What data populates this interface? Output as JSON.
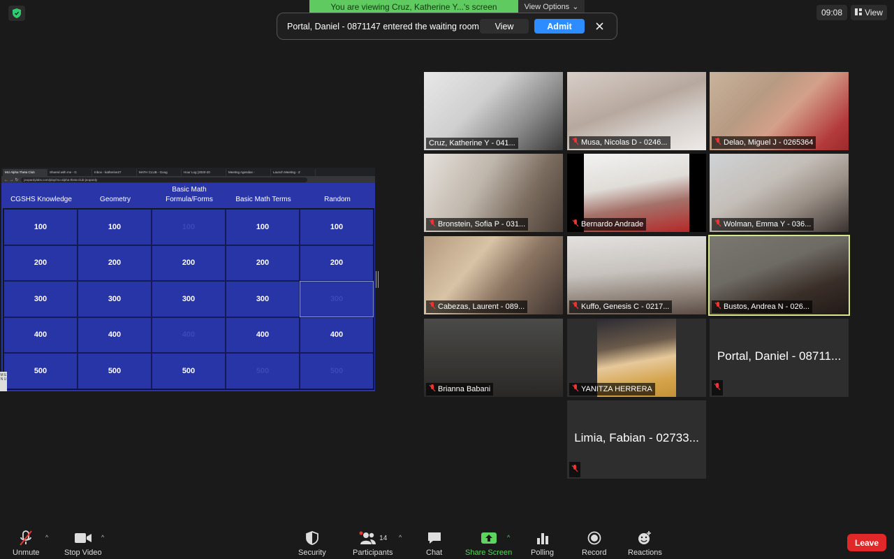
{
  "banner": {
    "sharing_text": "You are viewing Cruz, Katherine Y...'s screen",
    "view_options_label": "View Options"
  },
  "top_right": {
    "clock": "09:08",
    "view_label": "View"
  },
  "waiting_room": {
    "message": "Portal, Daniel - 0871147 entered the waiting room",
    "view_label": "View",
    "admit_label": "Admit"
  },
  "shared_screen": {
    "browser_tabs": [
      "MU Alpha Theta Club",
      "Shared with me - G",
      "Inbox - katherine27",
      "MATH CLUB - Goog",
      "Hour Log (2020-20",
      "Meeting Agendas -",
      "Launch Meeting - Z"
    ],
    "url": "jeopardylabs.com/play/mu-alpha-theta-club-jeopardy",
    "categories": [
      "CGSHS Knowledge",
      "Geometry",
      "Basic Math Formula/Forms",
      "Basic Math Terms",
      "Random"
    ],
    "rows": [
      [
        "100",
        "100",
        "100",
        "100",
        "100"
      ],
      [
        "200",
        "200",
        "200",
        "200",
        "200"
      ],
      [
        "300",
        "300",
        "300",
        "300",
        "300"
      ],
      [
        "400",
        "400",
        "400",
        "400",
        "400"
      ],
      [
        "500",
        "500",
        "500",
        "500",
        "500"
      ]
    ],
    "side_tab": "M E N U"
  },
  "participants": [
    "Cruz, Katherine Y - 041...",
    "Musa, Nicolas D - 0246...",
    "Delao, Miguel J - 0265364",
    "Bronstein, Sofia P - 031...",
    "Bernardo Andrade",
    "Wolman, Emma Y - 036...",
    "Cabezas, Laurent - 089...",
    "Kuffo, Genesis C - 0217...",
    "Bustos, Andrea N - 026...",
    "Brianna Babani",
    "YANITZA HERRERA",
    "Portal, Daniel - 08711...",
    "Limia, Fabian - 02733..."
  ],
  "toolbar": {
    "unmute": "Unmute",
    "stop_video": "Stop Video",
    "security": "Security",
    "participants": "Participants",
    "participants_count": "14",
    "chat": "Chat",
    "share_screen": "Share Screen",
    "polling": "Polling",
    "record": "Record",
    "reactions": "Reactions",
    "leave": "Leave"
  },
  "colors": {
    "accent": "#2d8cff",
    "share_green": "#5fca5f",
    "leave_red": "#e02828",
    "active_speaker": "#d6e88a"
  }
}
